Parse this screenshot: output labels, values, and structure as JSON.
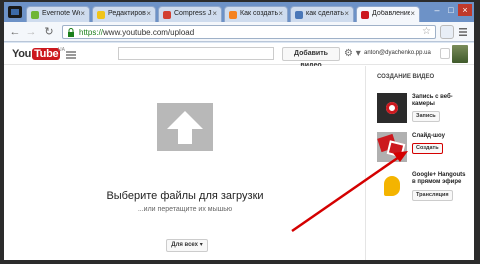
{
  "browser": {
    "tabs": [
      {
        "title": "Evernote Web",
        "favicon_color": "#6fb536"
      },
      {
        "title": "Редактирован",
        "favicon_color": "#f0c419"
      },
      {
        "title": "Compress JPE",
        "favicon_color": "#d23f31"
      },
      {
        "title": "Как создать с",
        "favicon_color": "#f58220"
      },
      {
        "title": "как сделать с",
        "favicon_color": "#4a77b8"
      },
      {
        "title": "Добавление с",
        "favicon_color": "#cc181e"
      }
    ],
    "url_scheme": "https://",
    "url_rest": "www.youtube.com/upload"
  },
  "header": {
    "logo_you": "You",
    "logo_tube": "Tube",
    "logo_region": "UA",
    "upload_label": "Добавить видео",
    "gear_icon": "⚙ ▾",
    "user_email": "anton@dyachenko.pp.ua"
  },
  "upload": {
    "title": "Выберите файлы для загрузки",
    "subtitle": "...или перетащите их мышью",
    "privacy_label": "Для всех ▾"
  },
  "side": {
    "title": "СОЗДАНИЕ ВИДЕО",
    "items": [
      {
        "label": "Запись с веб-камеры",
        "button": "Запись"
      },
      {
        "label": "Слайд-шоу",
        "button": "Создать"
      },
      {
        "label": "Google+ Hangouts в прямом эфире",
        "button": "Трансляция"
      }
    ]
  },
  "annotation_color": "#d40000"
}
